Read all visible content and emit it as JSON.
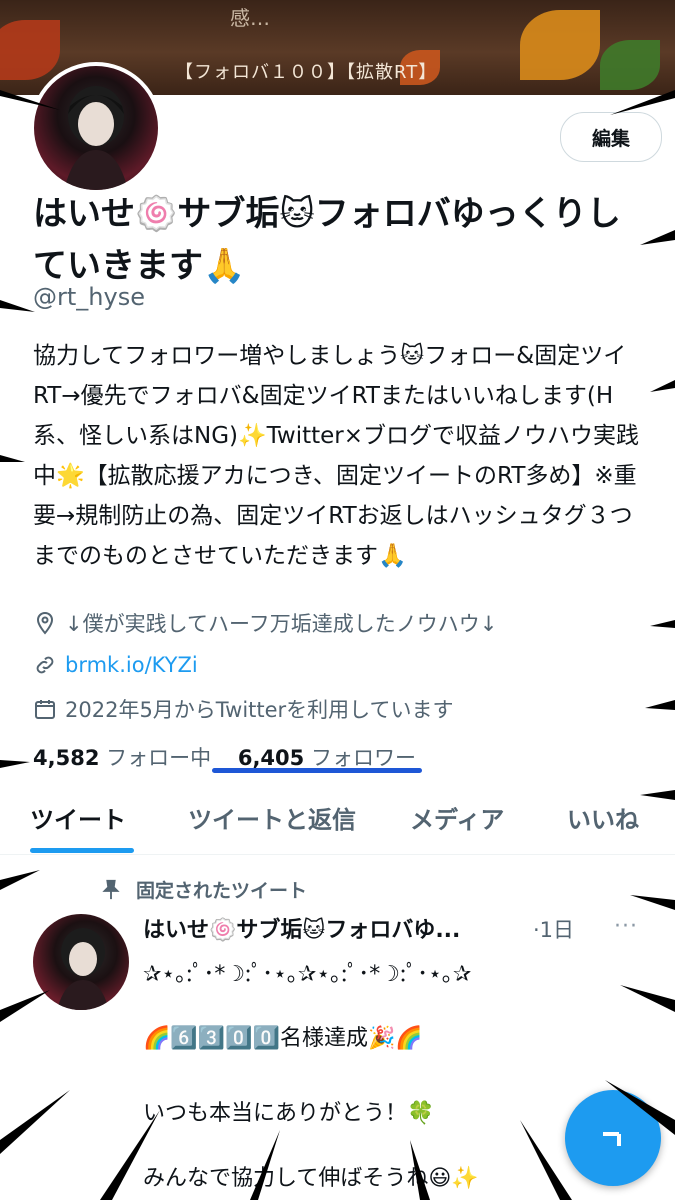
{
  "banner": {
    "top_text": "感…",
    "text": "【フォロバ１００】【拡散RT】"
  },
  "profile": {
    "edit_label": "編集",
    "display_name": "はいせ🍥サブ垢🐱フォロバゆっくりしていきます🙏",
    "handle": "@rt_hyse",
    "bio": "協力してフォロワー増やしましょう🐱フォロー&固定ツイRT→優先でフォロバ&固定ツイRTまたはいいねします(H系、怪しい系はNG)✨Twitter×ブログで収益ノウハウ実践中🌟【拡散応援アカにつき、固定ツイートのRT多め】※重要→規制防止の為、固定ツイRTお返しはハッシュタグ３つまでのものとさせていただきます🙏",
    "location": "↓僕が実践してハーフ万垢達成したノウハウ↓",
    "link": "brmk.io/KYZi",
    "joined": "2022年5月からTwitterを利用しています",
    "following_count": "4,582",
    "following_label": "フォロー中",
    "followers_count": "6,405",
    "followers_label": "フォロワー"
  },
  "tabs": [
    {
      "label": "ツイート"
    },
    {
      "label": "ツイートと返信"
    },
    {
      "label": "メディア"
    },
    {
      "label": "いいね"
    }
  ],
  "pinned_tweet": {
    "pinned_label": "固定されたツイート",
    "author": "はいせ🍥サブ垢🐱フォロバゆ...",
    "time": "·1日",
    "more": "···",
    "lines": [
      "✰⋆｡:ﾟ･*☽:ﾟ･⋆｡✰⋆｡:ﾟ･*☽:ﾟ･⋆｡✰",
      "🌈6️⃣3️⃣0️⃣0️⃣名様達成🎉🌈",
      "いつも本当にありがとう！🍀",
      "みんなで協力して伸ばそうね😃✨"
    ]
  },
  "fab": {
    "icon": "compose-icon"
  },
  "colors": {
    "accent": "#1d9bf0",
    "underline": "#1e57d6",
    "secondary": "#536471"
  }
}
